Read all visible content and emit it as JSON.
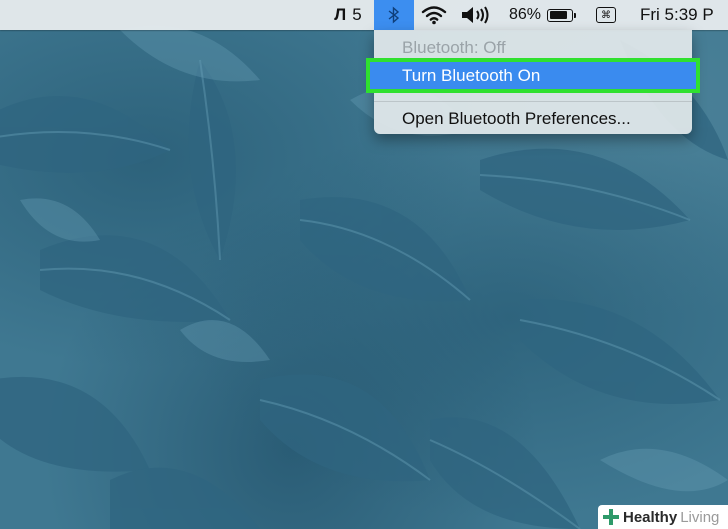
{
  "menubar": {
    "adobe_count": "5",
    "battery_percent": "86%",
    "battery_level": 0.86,
    "clock": "Fri 5:39 P",
    "icons": [
      "adobe-icon",
      "bluetooth-icon",
      "wifi-icon",
      "volume-icon",
      "battery-icon",
      "keyboard-icon"
    ]
  },
  "bluetooth_menu": {
    "status": "Bluetooth: Off",
    "turn_on": "Turn Bluetooth On",
    "open_prefs": "Open Bluetooth Preferences..."
  },
  "watermark": {
    "brand_bold": "Healthy",
    "brand_light": "Living"
  },
  "colors": {
    "highlight": "#3a8bef",
    "callout": "#2fe02f",
    "desktop": "#3f7891"
  }
}
